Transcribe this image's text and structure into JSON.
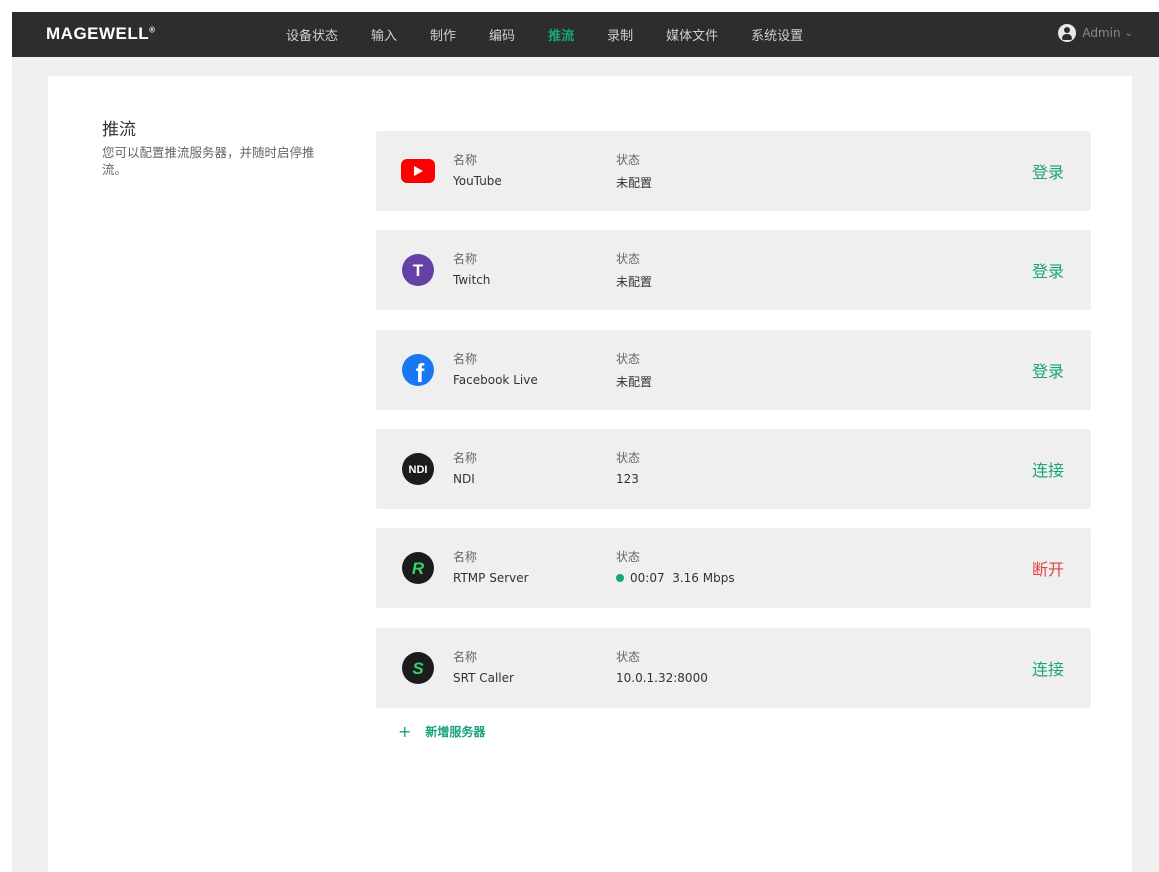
{
  "brand": {
    "logo_text": "MAGEWELL",
    "logo_mark": "®"
  },
  "nav": {
    "items": [
      "设备状态",
      "输入",
      "制作",
      "编码",
      "推流",
      "录制",
      "媒体文件",
      "系统设置"
    ],
    "active": "推流"
  },
  "user": {
    "name": "Admin",
    "chevron": "⌄"
  },
  "section": {
    "title": "推流",
    "description": "您可以配置推流服务器，并随时启停推流。"
  },
  "field_labels": {
    "name": "名称",
    "status": "状态"
  },
  "servers": [
    {
      "icon": "youtube-icon",
      "name": "YouTube",
      "status": "未配置",
      "action": "登录",
      "action_type": "primary"
    },
    {
      "icon": "twitch-icon",
      "icon_letter": "T",
      "name": "Twitch",
      "status": "未配置",
      "action": "登录",
      "action_type": "primary"
    },
    {
      "icon": "facebook-icon",
      "icon_letter": "f",
      "name": "Facebook Live",
      "status": "未配置",
      "action": "登录",
      "action_type": "primary"
    },
    {
      "icon": "ndi-icon",
      "icon_letter": "NDI",
      "name": "NDI",
      "status": "123",
      "action": "连接",
      "action_type": "primary"
    },
    {
      "icon": "rtmp-icon",
      "icon_letter": "R",
      "name": "RTMP Server",
      "status": "00:07  3.16 Mbps",
      "live": true,
      "action": "断开",
      "action_type": "danger"
    },
    {
      "icon": "srt-icon",
      "icon_letter": "S",
      "name": "SRT Caller",
      "status": "10.0.1.32:8000",
      "action": "连接",
      "action_type": "primary"
    }
  ],
  "add_server": {
    "plus": "+",
    "label": "新增服务器"
  },
  "colors": {
    "accent": "#1aa37c",
    "danger": "#e2443a",
    "topbar": "#2d2d2d",
    "youtube": "#ff0000",
    "twitch": "#6441a4",
    "facebook": "#1877f2",
    "dark_icon": "#1c1c1c",
    "rtmp_letter": "#34d36b"
  }
}
